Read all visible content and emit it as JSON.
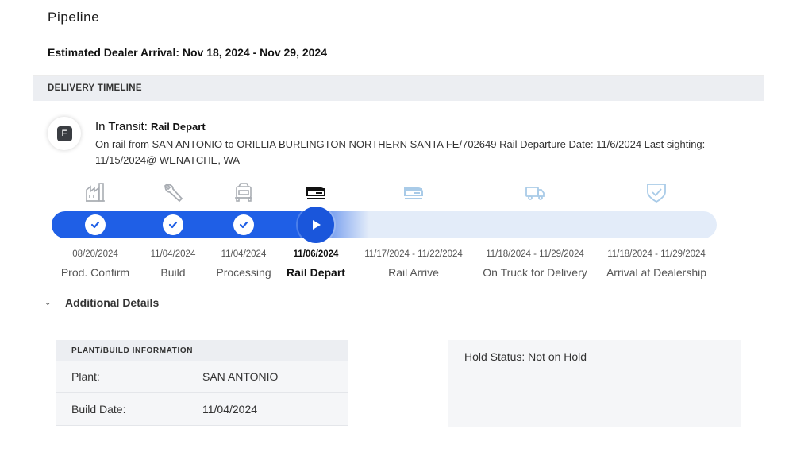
{
  "page": {
    "title": "Pipeline",
    "estimated_arrival": "Estimated Dealer Arrival: Nov 18, 2024 - Nov 29, 2024"
  },
  "timeline": {
    "header": "DELIVERY TIMELINE",
    "badge_letter": "F",
    "status_label": "In Transit:",
    "status_stage": "Rail Depart",
    "status_description": "On rail from SAN ANTONIO to ORILLIA BURLINGTON NORTHERN SANTA FE/702649 Rail Departure Date: 11/6/2024 Last sighting: 11/15/2024@ WENATCHE, WA",
    "progress_fraction": 0.46,
    "colors": {
      "active": "#1f5fe6",
      "inactive_icon": "#a9adb3",
      "future_icon": "#a9cbe8",
      "track": "#e3ecf9"
    },
    "milestones": [
      {
        "date": "08/20/2024",
        "name": "Prod. Confirm",
        "icon": "factory-icon",
        "state": "done"
      },
      {
        "date": "11/04/2024",
        "name": "Build",
        "icon": "wrench-icon",
        "state": "done"
      },
      {
        "date": "11/04/2024",
        "name": "Processing",
        "icon": "vehicle-front-icon",
        "state": "done"
      },
      {
        "date": "11/06/2024",
        "name": "Rail Depart",
        "icon": "train-icon",
        "state": "current"
      },
      {
        "date": "11/17/2024 - 11/22/2024",
        "name": "Rail Arrive",
        "icon": "train-icon",
        "state": "future"
      },
      {
        "date": "11/18/2024 - 11/29/2024",
        "name": "On Truck for Delivery",
        "icon": "truck-icon",
        "state": "future"
      },
      {
        "date": "11/18/2024 - 11/29/2024",
        "name": "Arrival at Dealership",
        "icon": "shield-check-icon",
        "state": "future"
      }
    ]
  },
  "details": {
    "toggle_label": "Additional Details",
    "plant": {
      "header": "PLANT/BUILD INFORMATION",
      "rows": [
        {
          "label": "Plant:",
          "value": "SAN ANTONIO"
        },
        {
          "label": "Build Date:",
          "value": "11/04/2024"
        }
      ]
    },
    "hold_status": "Hold Status: Not on Hold"
  }
}
